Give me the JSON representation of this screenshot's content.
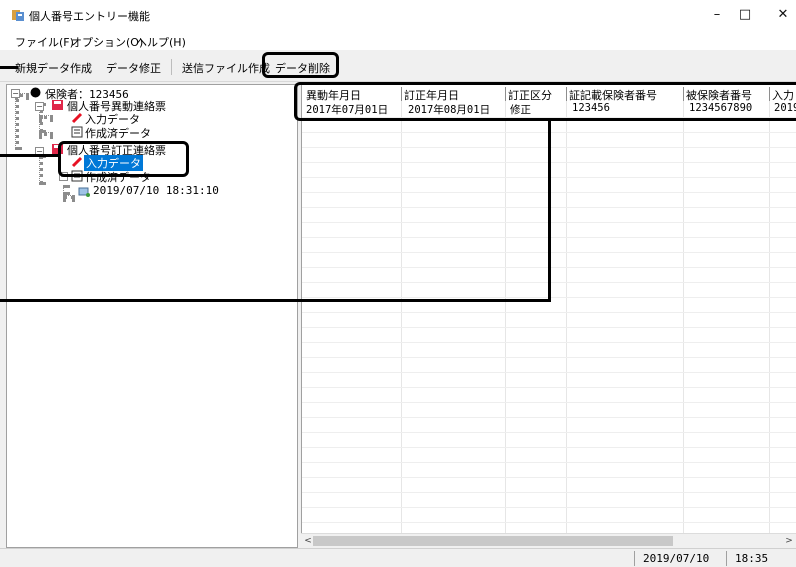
{
  "window": {
    "title": "個人番号エントリー機能",
    "controls": {
      "minimize": "–",
      "maximize": "□",
      "close": "✕"
    }
  },
  "menubar": {
    "items": [
      "ファイル(F)",
      "オプション(O)",
      "ヘルプ(H)"
    ]
  },
  "toolbar": {
    "new_data": "新規データ作成",
    "edit_data": "データ修正",
    "create_send_file": "送信ファイル作成",
    "delete_data": "データ削除"
  },
  "tree": {
    "root": "保険者：123456",
    "node1": "個人番号異動連絡票",
    "node1_child1": "入力データ",
    "node1_child2": "作成済データ",
    "node2": "個人番号訂正連絡票",
    "node2_child1": "入力データ",
    "node2_child2": "作成済データ",
    "node2_child2_item": "2019/07/10 18:31:10"
  },
  "grid": {
    "columns": [
      "異動年月日",
      "訂正年月日",
      "訂正区分",
      "証記載保険者番号",
      "被保険者番号",
      "入力"
    ],
    "rows": [
      [
        "2017年07月01日",
        "2017年08月01日",
        "修正",
        "123456",
        "1234567890",
        "2019"
      ]
    ]
  },
  "scrollbar": {
    "left_arrow": "<",
    "right_arrow": ">"
  },
  "statusbar": {
    "date": "2019/07/10",
    "time": "18:35"
  },
  "colors": {
    "selection": "#0078d7",
    "pencil": "#e81123",
    "book": "#e0284a"
  }
}
